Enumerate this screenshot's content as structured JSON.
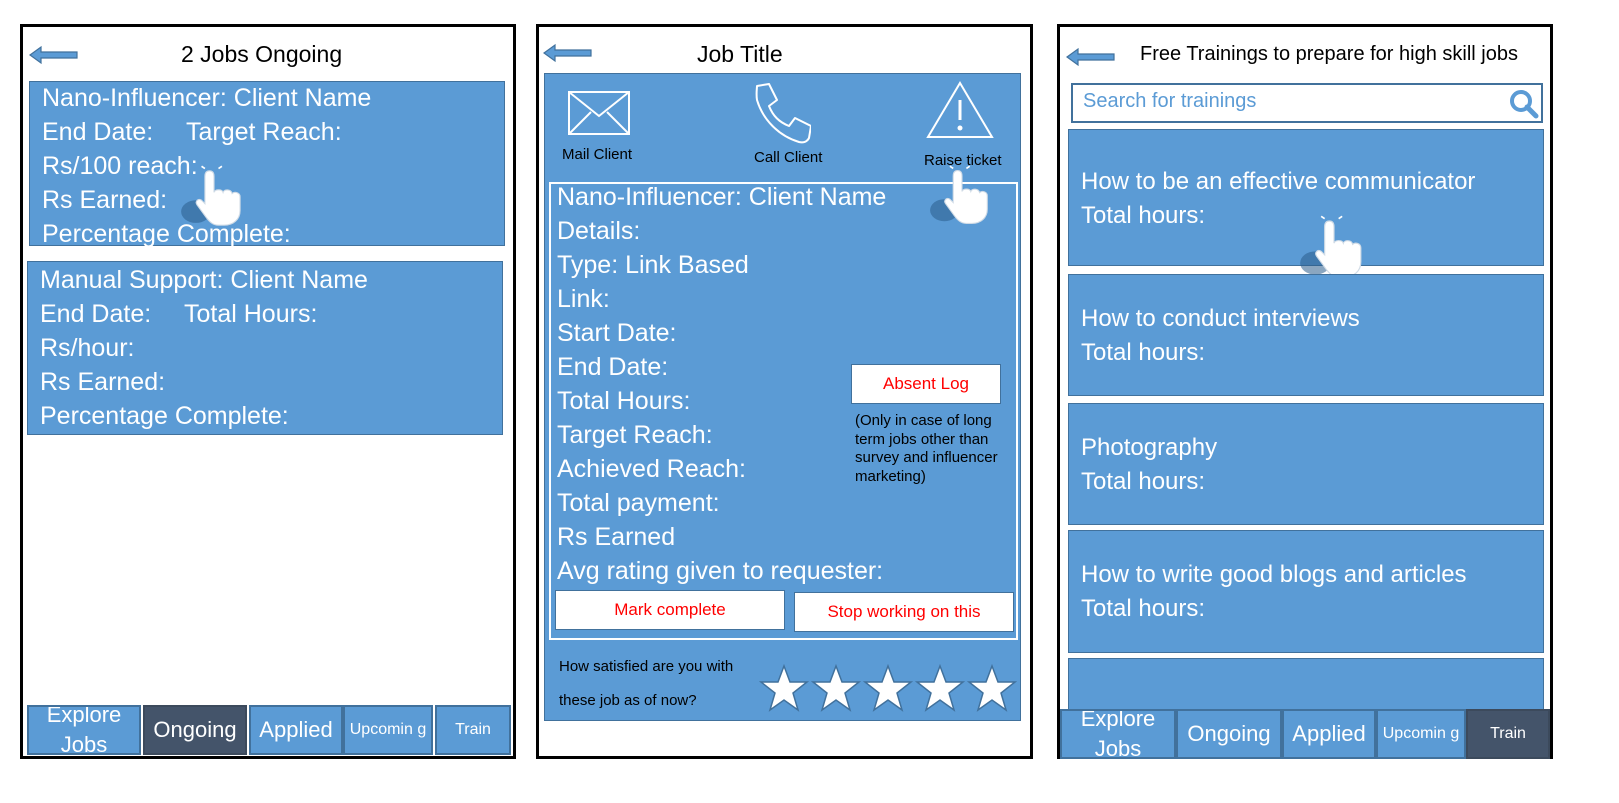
{
  "screen1": {
    "title": "2 Jobs Ongoing",
    "job1": {
      "line1": "Nano-Influencer: Client Name",
      "end_date": "End Date:",
      "target_reach": "Target Reach:",
      "rate": "Rs/100 reach:",
      "earned": "Rs Earned:",
      "percent": "Percentage Complete:"
    },
    "job2": {
      "line1": "Manual Support: Client Name",
      "end_date": "End Date:",
      "total_hours": "Total Hours:",
      "rate": "Rs/hour:",
      "earned": "Rs Earned:",
      "percent": "Percentage Complete:"
    },
    "tabs": {
      "explore": "Explore Jobs",
      "ongoing": "Ongoing",
      "applied": "Applied",
      "upcoming": "Upcomin g",
      "train": "Train"
    }
  },
  "screen2": {
    "title": "Job Title",
    "actions": {
      "mail": "Mail Client",
      "call": "Call Client",
      "ticket": "Raise ticket"
    },
    "details": {
      "line1": "Nano-Influencer: Client Name",
      "details": "Details:",
      "type": "Type: Link Based",
      "link": "Link:",
      "start": "Start Date:",
      "end": "End Date:",
      "hours": "Total Hours:",
      "target": "Target Reach:",
      "achieved": "Achieved Reach:",
      "payment": "Total payment:",
      "earned": "Rs Earned",
      "rating": "Avg rating given to requester:"
    },
    "absent_log": "Absent Log",
    "absent_note": [
      "(Only in case of long",
      "term jobs other than",
      "survey and influencer",
      "marketing)"
    ],
    "mark_complete": "Mark complete",
    "stop_working": "Stop working on this",
    "satisfaction_line1": "How satisfied are you with",
    "satisfaction_line2": "these job as of now?",
    "stars": 5
  },
  "screen3": {
    "title": "Free Trainings to prepare for high skill jobs",
    "search_placeholder": "Search for trainings",
    "trainings": [
      {
        "name": "How to be an effective communicator",
        "hours": "Total hours:"
      },
      {
        "name": "How to conduct interviews",
        "hours": "Total hours:"
      },
      {
        "name": "Photography",
        "hours": "Total hours:"
      },
      {
        "name": "How to write good blogs and articles",
        "hours": "Total hours:"
      }
    ],
    "tabs": {
      "explore": "Explore Jobs",
      "ongoing": "Ongoing",
      "applied": "Applied",
      "upcoming": "Upcomin g",
      "train": "Train"
    }
  },
  "colors": {
    "panel_blue": "#5b9bd5",
    "panel_border": "#41719c",
    "active_tab": "#44546a",
    "alert_red": "#ff0000"
  }
}
